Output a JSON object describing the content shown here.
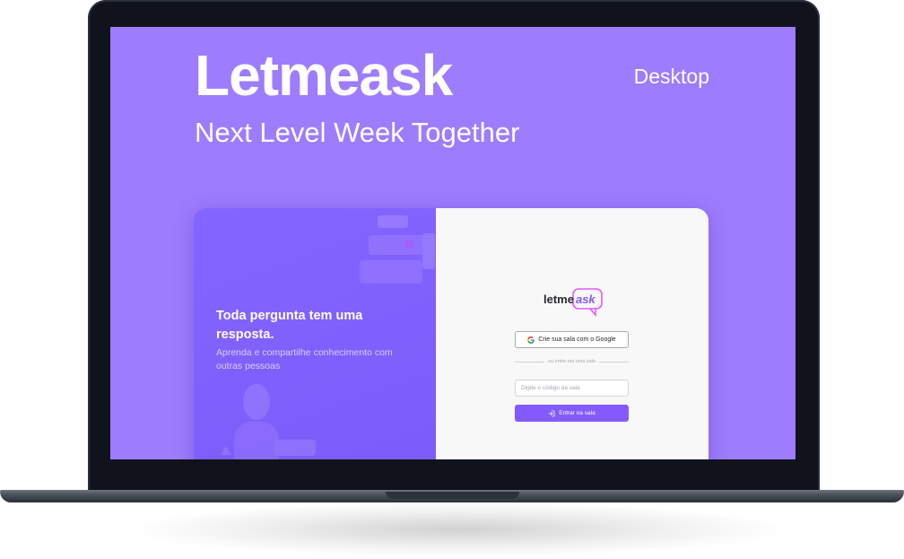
{
  "hero": {
    "title": "Letmeask",
    "subtitle": "Next Level Week Together",
    "platform": "Desktop"
  },
  "app": {
    "aside": {
      "heading": "Toda pergunta tem uma resposta.",
      "text": "Aprenda e compartilhe conhecimento com outras pessoas"
    },
    "logo": {
      "text_a": "letme",
      "text_b": "ask"
    },
    "google_button": {
      "label": "Crie sua sala com o Google",
      "icon": "google-icon"
    },
    "separator": {
      "label": "ou entre em uma sala"
    },
    "room_code_input": {
      "placeholder": "Digite o código da sala",
      "value": ""
    },
    "enter_button": {
      "label": "Entrar na sala",
      "icon": "login-icon"
    }
  },
  "colors": {
    "screen_bg": "#9d7cfe",
    "aside_bg": "#835afd",
    "form_bg": "#f8f8f8",
    "button_primary": "#835afd",
    "logo_accent": "#e559f9"
  }
}
